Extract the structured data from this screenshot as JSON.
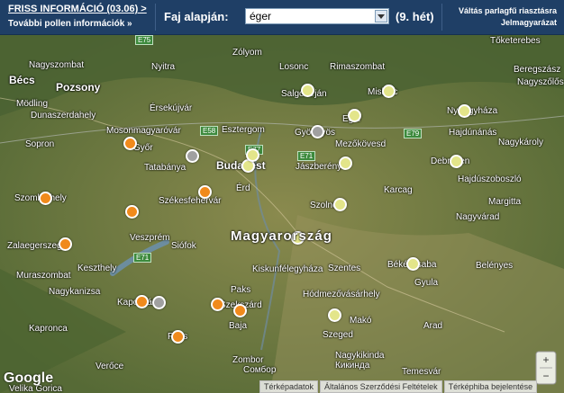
{
  "header": {
    "fresh_info": "FRISS INFORMÁCIÓ (03.06) >",
    "more_pollen": "További pollen információk »",
    "species_label": "Faj alapján:",
    "species_selected": "éger",
    "week": "(9. hét)",
    "switch_line1": "Váltás parlagfű riasztásra",
    "switch_line2": "Jelmagyarázat"
  },
  "map": {
    "country_label": "Magyarország",
    "places": [
      {
        "name": "Bécs",
        "cls": "med"
      },
      {
        "name": "Pozsony",
        "cls": "med"
      },
      {
        "name": "Nagyszombat",
        "cls": ""
      },
      {
        "name": "Nyitra",
        "cls": ""
      },
      {
        "name": "Zólyom",
        "cls": ""
      },
      {
        "name": "Losonc",
        "cls": ""
      },
      {
        "name": "Rimaszombat",
        "cls": ""
      },
      {
        "name": "Tőketerebes",
        "cls": ""
      },
      {
        "name": "Beregszász",
        "cls": ""
      },
      {
        "name": "Nagyszőlős",
        "cls": ""
      },
      {
        "name": "Mödling",
        "cls": ""
      },
      {
        "name": "Dunaszerdahely",
        "cls": ""
      },
      {
        "name": "Érsekújvár",
        "cls": ""
      },
      {
        "name": "Salgótarján",
        "cls": ""
      },
      {
        "name": "Miskolc",
        "cls": ""
      },
      {
        "name": "Nyíregyháza",
        "cls": ""
      },
      {
        "name": "Mosonmagyaróvár",
        "cls": ""
      },
      {
        "name": "Esztergom",
        "cls": ""
      },
      {
        "name": "Eger",
        "cls": ""
      },
      {
        "name": "Hajdúnánás",
        "cls": ""
      },
      {
        "name": "Sopron",
        "cls": ""
      },
      {
        "name": "Győr",
        "cls": ""
      },
      {
        "name": "Gyöngyös",
        "cls": ""
      },
      {
        "name": "Mezőkövesd",
        "cls": ""
      },
      {
        "name": "Nagykároly",
        "cls": ""
      },
      {
        "name": "Tatabánya",
        "cls": ""
      },
      {
        "name": "Budapest",
        "cls": "med"
      },
      {
        "name": "Jászberény",
        "cls": ""
      },
      {
        "name": "Debrecen",
        "cls": ""
      },
      {
        "name": "Érd",
        "cls": ""
      },
      {
        "name": "Hajdúszoboszló",
        "cls": ""
      },
      {
        "name": "Szombathely",
        "cls": ""
      },
      {
        "name": "Székesfehérvár",
        "cls": ""
      },
      {
        "name": "Szolnok",
        "cls": ""
      },
      {
        "name": "Karcag",
        "cls": ""
      },
      {
        "name": "Margitta",
        "cls": ""
      },
      {
        "name": "Veszprém",
        "cls": ""
      },
      {
        "name": "Nagyvárad",
        "cls": ""
      },
      {
        "name": "Zalaegerszeg",
        "cls": ""
      },
      {
        "name": "Siófok",
        "cls": ""
      },
      {
        "name": "Keszthely",
        "cls": ""
      },
      {
        "name": "Kiskunfélegyháza",
        "cls": ""
      },
      {
        "name": "Szentes",
        "cls": ""
      },
      {
        "name": "Békéscsaba",
        "cls": ""
      },
      {
        "name": "Muraszombat",
        "cls": ""
      },
      {
        "name": "Gyula",
        "cls": ""
      },
      {
        "name": "Belényes",
        "cls": ""
      },
      {
        "name": "Nagykanizsa",
        "cls": ""
      },
      {
        "name": "Paks",
        "cls": ""
      },
      {
        "name": "Kaposvár",
        "cls": ""
      },
      {
        "name": "Szekszárd",
        "cls": ""
      },
      {
        "name": "Hódmezővásárhely",
        "cls": ""
      },
      {
        "name": "Baja",
        "cls": ""
      },
      {
        "name": "Makó",
        "cls": ""
      },
      {
        "name": "Arad",
        "cls": ""
      },
      {
        "name": "Kapronca",
        "cls": ""
      },
      {
        "name": "Szeged",
        "cls": ""
      },
      {
        "name": "Pécs",
        "cls": ""
      },
      {
        "name": "Temesvár",
        "cls": ""
      },
      {
        "name": "Zombor",
        "cls": ""
      },
      {
        "name": "Сомбор",
        "cls": ""
      },
      {
        "name": "Nagykikinda",
        "cls": ""
      },
      {
        "name": "Кикинда",
        "cls": ""
      },
      {
        "name": "Verőce",
        "cls": ""
      },
      {
        "name": "Velika Gorica",
        "cls": ""
      }
    ],
    "roads": [
      "E75",
      "E58",
      "E77",
      "E71",
      "E79",
      "E71"
    ],
    "markers": [
      {
        "color": "orange"
      },
      {
        "color": "orange"
      },
      {
        "color": "orange"
      },
      {
        "color": "orange"
      },
      {
        "color": "orange"
      },
      {
        "color": "orange"
      },
      {
        "color": "orange"
      },
      {
        "color": "orange"
      },
      {
        "color": "orange"
      },
      {
        "color": "grey"
      },
      {
        "color": "grey"
      },
      {
        "color": "grey"
      },
      {
        "color": "yellow"
      },
      {
        "color": "yellow"
      },
      {
        "color": "yellow"
      },
      {
        "color": "yellow"
      },
      {
        "color": "yellow"
      },
      {
        "color": "yellow"
      },
      {
        "color": "yellow"
      },
      {
        "color": "yellow"
      },
      {
        "color": "yellow"
      },
      {
        "color": "yellow"
      },
      {
        "color": "yellow"
      },
      {
        "color": "yellow"
      }
    ],
    "google_label": "Google"
  },
  "footer": {
    "map_data": "Térképadatok",
    "terms": "Általános Szerződési Feltételek",
    "report": "Térképhiba bejelentése"
  },
  "colors": {
    "header": "#1f3f66",
    "orange": "#f08a1c",
    "yellow": "#e3e58a",
    "grey": "#a0a0a0"
  }
}
